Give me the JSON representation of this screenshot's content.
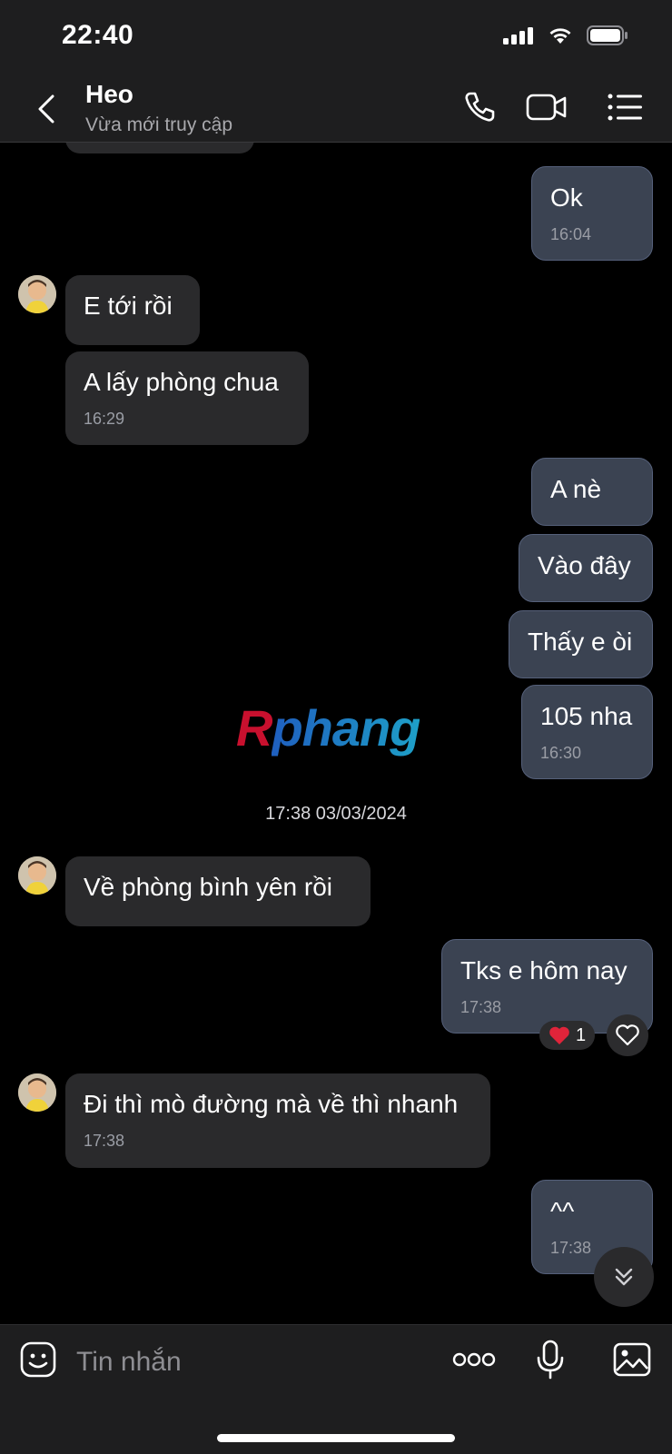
{
  "status_bar": {
    "time": "22:40"
  },
  "header": {
    "contact_name": "Heo",
    "contact_status": "Vừa mới truy cập"
  },
  "messages": {
    "m1": {
      "text": "Ok",
      "time": "16:04"
    },
    "m2": {
      "text": "E tới rồi"
    },
    "m3": {
      "text": "A lấy phòng chua",
      "time": "16:29"
    },
    "m4": {
      "text": "A nè"
    },
    "m5": {
      "text": "Vào đây"
    },
    "m6": {
      "text": "Thấy e òi"
    },
    "m7": {
      "text": "105 nha",
      "time": "16:30"
    },
    "m8": {
      "text": "Về phòng bình yên rồi"
    },
    "m9": {
      "text": "Tks e hôm nay",
      "time": "17:38",
      "reaction_count": "1"
    },
    "m10": {
      "text": "Đi thì mò đường mà về thì nhanh",
      "time": "17:38"
    },
    "m11": {
      "text": "^^",
      "time": "17:38"
    }
  },
  "date_separator": "17:38 03/03/2024",
  "watermark": "Rphang",
  "input": {
    "placeholder": "Tin nhắn"
  },
  "colors": {
    "incoming_bubble": "#2a2a2c",
    "outgoing_bubble": "#3b4352",
    "background": "#000000",
    "bar": "#1e1e1f"
  }
}
